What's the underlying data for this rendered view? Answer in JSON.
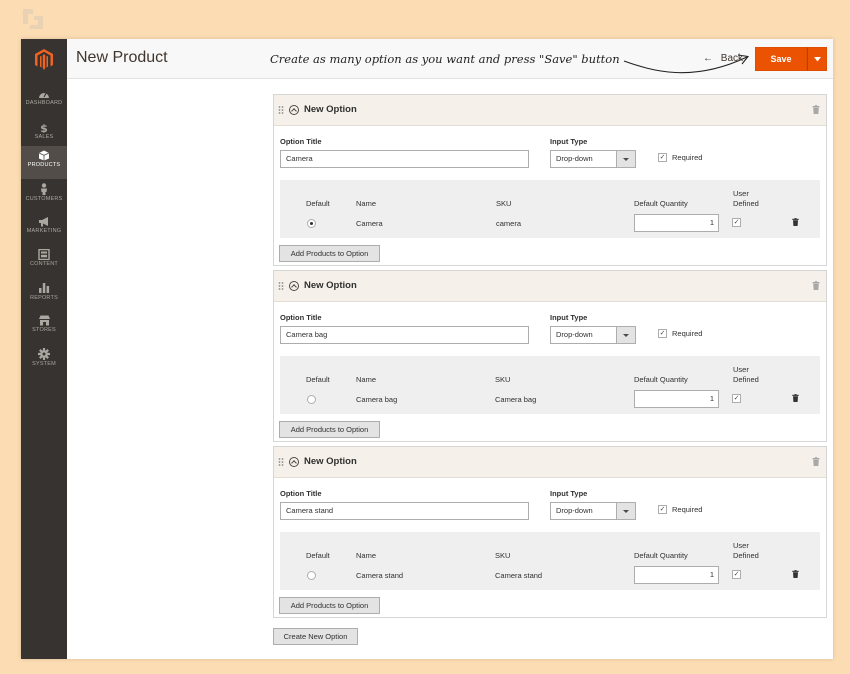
{
  "header": {
    "title": "New Product",
    "annotation": "Create as many option as you want and press \"Save\" button",
    "back_label": "Back",
    "save_label": "Save"
  },
  "sidebar": {
    "items": [
      {
        "label": "Dashboard",
        "icon": "dashboard-icon"
      },
      {
        "label": "Sales",
        "icon": "dollar-icon"
      },
      {
        "label": "Products",
        "icon": "box-icon",
        "active": true
      },
      {
        "label": "Customers",
        "icon": "person-icon"
      },
      {
        "label": "Marketing",
        "icon": "megaphone-icon"
      },
      {
        "label": "Content",
        "icon": "layout-icon"
      },
      {
        "label": "Reports",
        "icon": "bar-chart-icon"
      },
      {
        "label": "Stores",
        "icon": "store-icon"
      },
      {
        "label": "System",
        "icon": "gear-icon"
      }
    ]
  },
  "labels": {
    "option_heading": "New Option",
    "option_title": "Option Title",
    "input_type": "Input Type",
    "required": "Required",
    "col_default": "Default",
    "col_name": "Name",
    "col_sku": "SKU",
    "col_qty": "Default Quantity",
    "col_user_line1": "User",
    "col_user_line2": "Defined",
    "add_products": "Add Products to Option",
    "create_option": "Create New Option"
  },
  "options": [
    {
      "title": "Camera",
      "input_type": "Drop-down",
      "required": true,
      "row": {
        "default": true,
        "name": "Camera",
        "sku": "camera",
        "qty": "1",
        "user_defined": true
      }
    },
    {
      "title": "Camera bag",
      "input_type": "Drop-down",
      "required": true,
      "row": {
        "default": false,
        "name": "Camera bag",
        "sku": "Camera bag",
        "qty": "1",
        "user_defined": true
      }
    },
    {
      "title": "Camera stand",
      "input_type": "Drop-down",
      "required": true,
      "row": {
        "default": false,
        "name": "Camera stand",
        "sku": "Camera stand",
        "qty": "1",
        "user_defined": true
      }
    }
  ],
  "colors": {
    "accent": "#eb5202",
    "sidebar": "#373330",
    "background": "#fcdcb2"
  }
}
